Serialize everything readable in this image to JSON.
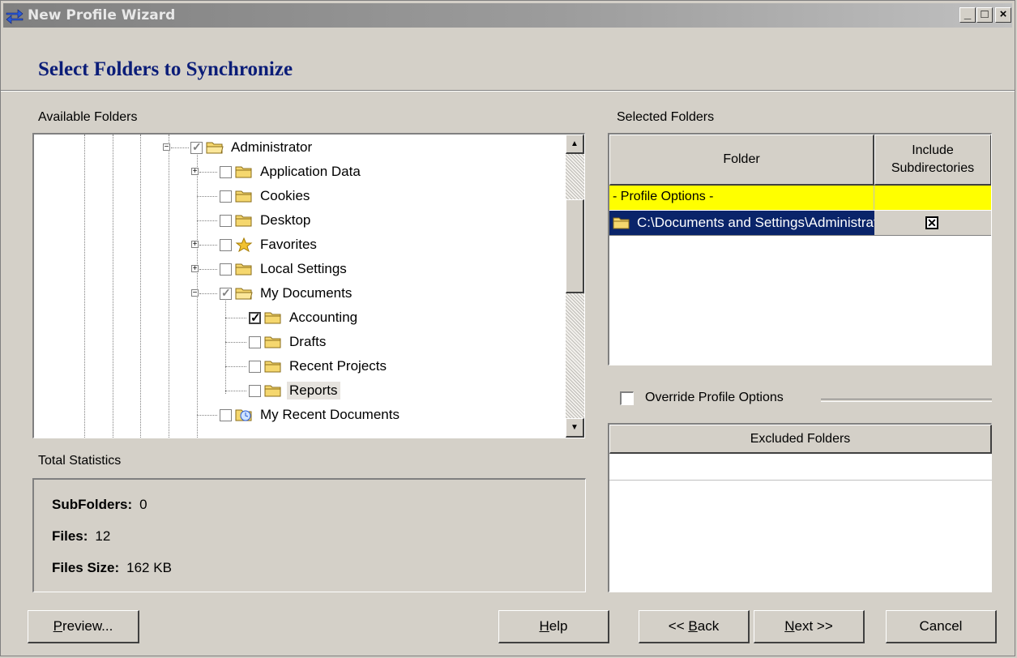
{
  "window": {
    "title": "New Profile Wizard",
    "minimize_label": "_",
    "maximize_label": "□",
    "close_label": "×"
  },
  "page": {
    "heading": "Select Folders to Synchronize"
  },
  "available": {
    "label": "Available Folders",
    "tree": [
      {
        "label": "Administrator",
        "state": "grey-checked",
        "icon": "folder-open-icon",
        "expander": "minus"
      },
      {
        "label": "Application Data",
        "state": "unchecked",
        "icon": "folder-icon",
        "expander": "plus"
      },
      {
        "label": "Cookies",
        "state": "unchecked",
        "icon": "folder-icon",
        "expander": ""
      },
      {
        "label": "Desktop",
        "state": "unchecked",
        "icon": "folder-icon",
        "expander": ""
      },
      {
        "label": "Favorites",
        "state": "unchecked",
        "icon": "star-icon",
        "expander": "plus"
      },
      {
        "label": "Local Settings",
        "state": "unchecked",
        "icon": "folder-icon",
        "expander": "plus"
      },
      {
        "label": "My Documents",
        "state": "grey-checked",
        "icon": "folder-open-icon",
        "expander": "minus"
      },
      {
        "label": "Accounting",
        "state": "checked",
        "icon": "folder-icon",
        "expander": ""
      },
      {
        "label": "Drafts",
        "state": "unchecked",
        "icon": "folder-icon",
        "expander": ""
      },
      {
        "label": "Recent Projects",
        "state": "unchecked",
        "icon": "folder-icon",
        "expander": ""
      },
      {
        "label": "Reports",
        "state": "unchecked",
        "icon": "folder-icon",
        "expander": ""
      },
      {
        "label": "My Recent Documents",
        "state": "unchecked",
        "icon": "recent-docs-icon",
        "expander": ""
      }
    ]
  },
  "stats": {
    "label": "Total Statistics",
    "subfolders_label": "SubFolders:",
    "subfolders_value": "0",
    "files_label": "Files:",
    "files_value": "12",
    "size_label": "Files Size:",
    "size_value": "162 KB"
  },
  "selected": {
    "label": "Selected Folders",
    "col_folder": "Folder",
    "col_include_1": "Include",
    "col_include_2": "Subdirectories",
    "profile_options_row": "- Profile Options -",
    "folder_row": "C:\\Documents and Settings\\Administrator\\My Documents",
    "include_checked": true
  },
  "override": {
    "label": "Override Profile Options",
    "checked": false
  },
  "excluded": {
    "col_header": "Excluded Folders"
  },
  "buttons": {
    "preview": "Preview...",
    "help": "Help",
    "back": "<< Back",
    "next": "Next >>",
    "cancel": "Cancel"
  },
  "colors": {
    "title_text": "#e8e8e8",
    "heading": "#0b1d78",
    "profile_options_bg": "#ffff00",
    "selection_bg": "#0a246a",
    "face": "#d4d0c8"
  }
}
